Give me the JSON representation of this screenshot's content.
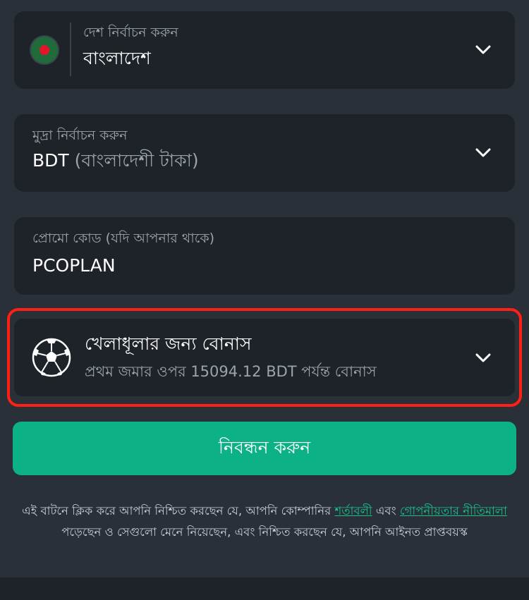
{
  "country": {
    "label": "দেশ নির্বাচন করুন",
    "value": "বাংলাদেশ",
    "flag_icon": "bangladesh-flag-icon",
    "flag_colors": {
      "field": "#1f6b3a",
      "disc": "#e3142c"
    }
  },
  "currency": {
    "label": "মুদ্রা নির্বাচন করুন",
    "code": "BDT",
    "name": "(বাংলাদেশী টাকা)"
  },
  "promo": {
    "label": "প্রোমো কোড (যদি আপনার থাকে)",
    "value": "PCOPLAN"
  },
  "bonus": {
    "title": "খেলাধূলার জন্য বোনাস",
    "subtitle": "প্রথম জমার ওপর 15094.12 BDT পর্যন্ত বোনাস",
    "icon": "soccer-ball-icon",
    "highlight_color": "#ff1f14"
  },
  "register": {
    "label": "নিবন্ধন করুন",
    "color": "#0cb185"
  },
  "terms": {
    "part1": "এই বাটনে ক্লিক করে আপনি নিশ্চিত করছেন যে, আপনি কোম্পানির ",
    "terms_link": "শর্তাবলী",
    "part2": " এবং ",
    "privacy_link": "গোপনীয়তার নীতিমালা",
    "part3": " পড়েছেন ও সেগুলো মেনে নিয়েছেন, এবং নিশ্চিত করছেন যে, আপনি আইনত প্রাপ্তবয়স্ক",
    "link_color": "#14c28f"
  }
}
